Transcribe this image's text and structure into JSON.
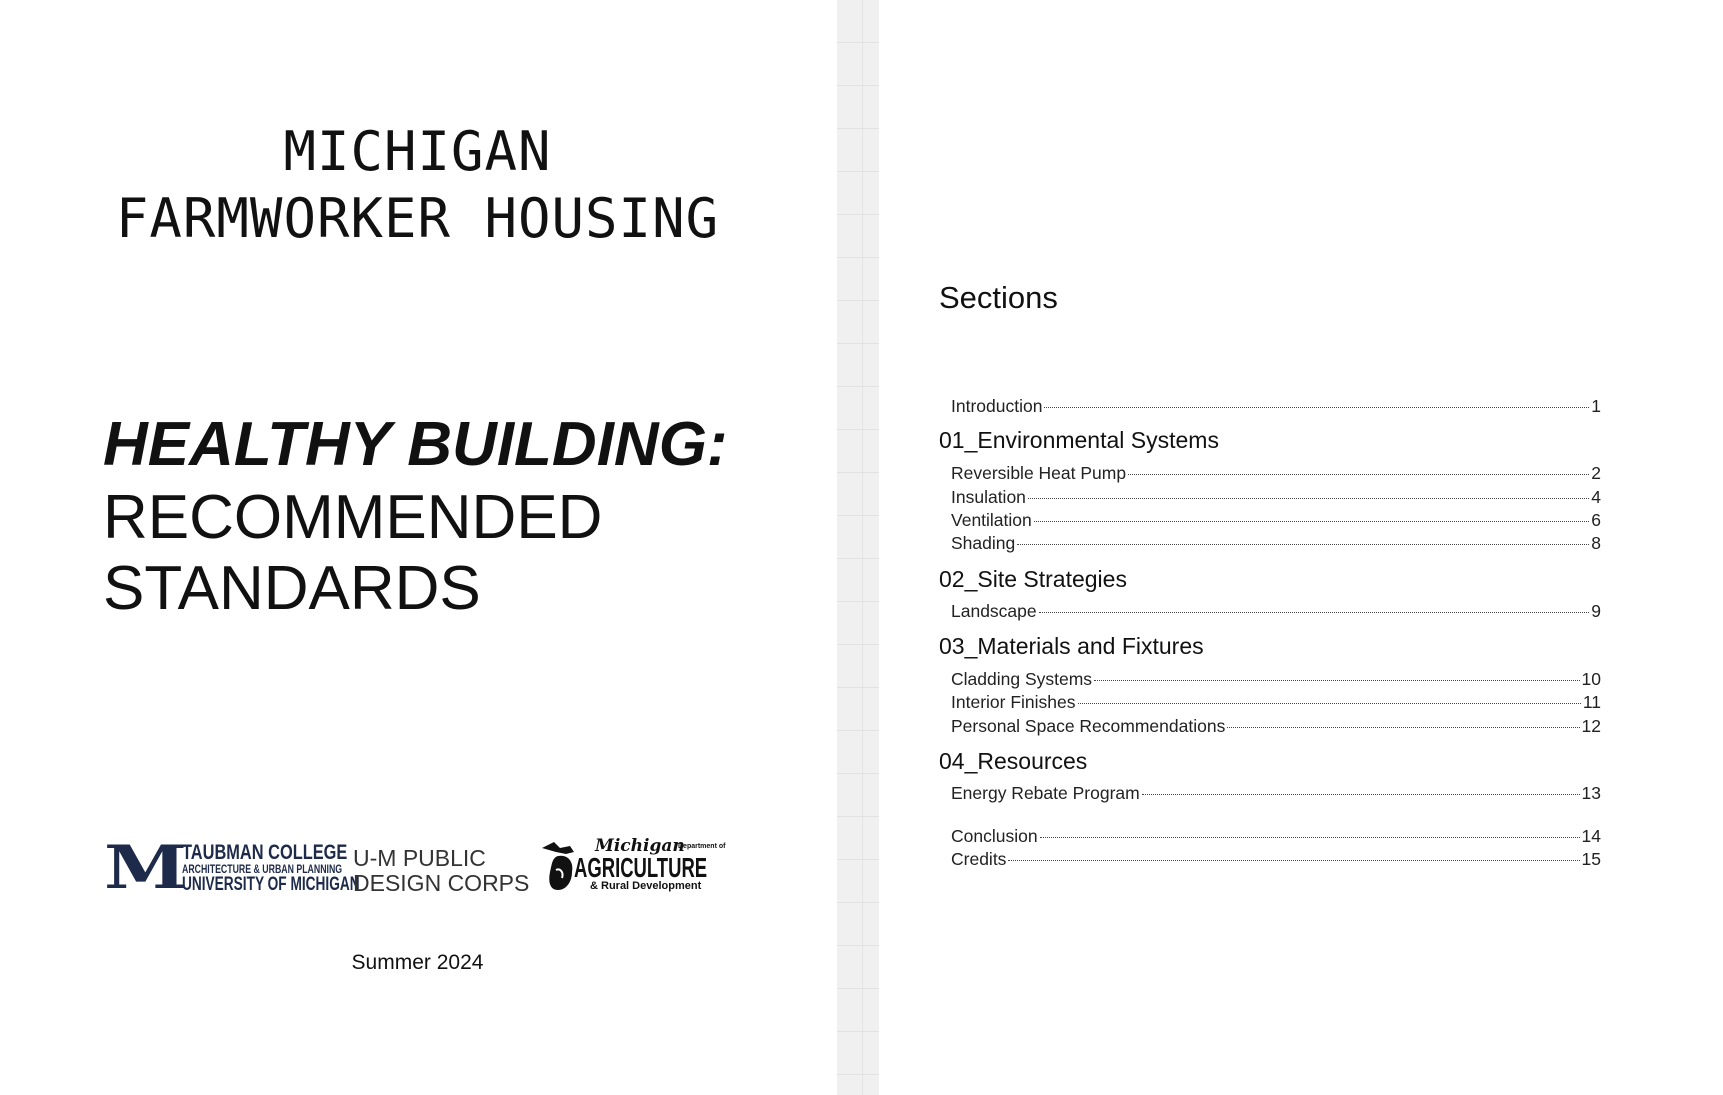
{
  "cover": {
    "title_line1": "MICHIGAN",
    "title_line2": "FARMWORKER HOUSING",
    "subtitle_bold": "HEALTHY BUILDING:",
    "subtitle_line2": "RECOMMENDED",
    "subtitle_line3": "STANDARDS",
    "logos": {
      "taubman": {
        "mark": "M",
        "line1": "TAUBMAN COLLEGE",
        "line2": "ARCHITECTURE & URBAN PLANNING",
        "line3": "UNIVERSITY OF MICHIGAN",
        "color": "#1d2a4a"
      },
      "public_design_corps": {
        "line1": "U-M PUBLIC",
        "line2": "DESIGN CORPS"
      },
      "mdard": {
        "script": "Michigan",
        "dept": "Department of",
        "main": "AGRICULTURE",
        "sub": "& Rural Development"
      }
    },
    "date": "Summer 2024"
  },
  "toc": {
    "title": "Sections",
    "intro": {
      "label": "Introduction",
      "page": "1"
    },
    "groups": [
      {
        "heading": "01_Environmental Systems",
        "entries": [
          {
            "label": "Reversible Heat Pump",
            "page": "2"
          },
          {
            "label": "Insulation",
            "page": "4"
          },
          {
            "label": "Ventilation",
            "page": "6"
          },
          {
            "label": "Shading",
            "page": "8"
          }
        ]
      },
      {
        "heading": "02_Site Strategies",
        "entries": [
          {
            "label": "Landscape",
            "page": "9"
          }
        ]
      },
      {
        "heading": "03_Materials and Fixtures",
        "entries": [
          {
            "label": "Cladding Systems",
            "page": "10"
          },
          {
            "label": "Interior Finishes",
            "page": "11"
          },
          {
            "label": "Personal Space Recommendations",
            "page": "12"
          }
        ]
      },
      {
        "heading": "04_Resources",
        "entries": [
          {
            "label": "Energy Rebate Program",
            "page": "13"
          }
        ]
      }
    ],
    "closing": [
      {
        "label": "Conclusion",
        "page": "14"
      },
      {
        "label": "Credits",
        "page": "15"
      }
    ]
  }
}
